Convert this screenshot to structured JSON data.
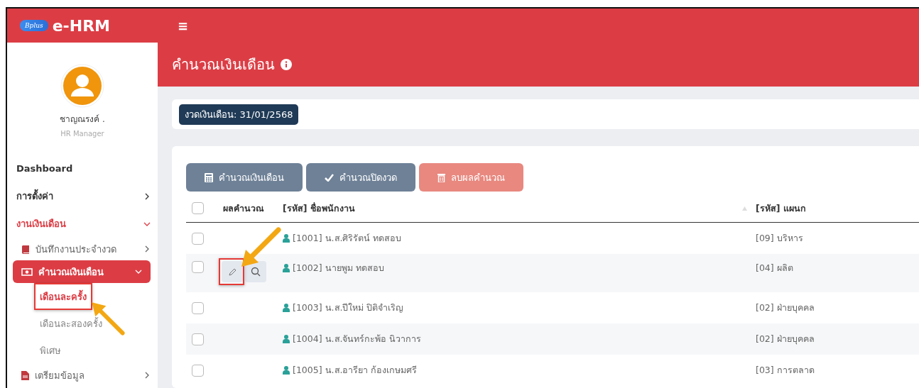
{
  "topbar": {
    "logo_badge": "Bplus",
    "brand": "e-HRM",
    "menu_glyph": "≡"
  },
  "sidebar": {
    "user": {
      "name": "ชาญณรงค์ .",
      "role": "HR Manager"
    },
    "items": [
      {
        "label": "Dashboard",
        "kind": "plain",
        "active": false
      },
      {
        "label": "การตั้งค่า",
        "kind": "group",
        "active": false,
        "expanded": false
      },
      {
        "label": "งานเงินเดือน",
        "kind": "group",
        "active": true,
        "expanded": true,
        "children": [
          {
            "label": "บันทึกงานประจำงวด",
            "kind": "book",
            "selected": false,
            "expanded": false
          },
          {
            "label": "คำนวณเงินเดือน",
            "kind": "money",
            "selected": true,
            "expanded": true,
            "children": [
              {
                "label": "เดือนละครั้ง",
                "selected": true,
                "highlighted": true
              },
              {
                "label": "เดือนละสองครั้ง",
                "selected": false,
                "highlighted": false
              },
              {
                "label": "พิเศษ",
                "selected": false,
                "highlighted": false
              }
            ]
          },
          {
            "label": "เตรียมข้อมูล",
            "kind": "file",
            "selected": false,
            "expanded": false
          }
        ]
      }
    ]
  },
  "page": {
    "title": "คำนวณเงินเดือน",
    "period": "งวดเงินเดือน: 31/01/2568"
  },
  "actions": [
    {
      "label": "คำนวณเงินเดือน",
      "kind": "calculator",
      "disabled": false
    },
    {
      "label": "คำนวณปิดงวด",
      "kind": "check",
      "disabled": false
    },
    {
      "label": "ลบผลคำนวณ",
      "kind": "trash",
      "disabled": false
    }
  ],
  "table": {
    "header_checked": false,
    "columns": [
      "ผลคำนวณ",
      "[รหัส] ชื่อพนักงาน",
      "[รหัส] แผนก"
    ],
    "rows": [
      {
        "checked": false,
        "has_result": false,
        "highlighted": false,
        "employee": "[1001] น.ส.ศิริรัตน์ ทดสอบ",
        "department": "[09] บริหาร"
      },
      {
        "checked": false,
        "has_result": true,
        "highlighted": true,
        "employee": "[1002] นายพูม ทดสอบ",
        "department": "[04] ผลิต"
      },
      {
        "checked": false,
        "has_result": false,
        "highlighted": false,
        "employee": "[1003] น.ส.ปีใหม่ ปิติจำเริญ",
        "department": "[02] ฝ่ายบุคคล"
      },
      {
        "checked": false,
        "has_result": false,
        "highlighted": false,
        "employee": "[1004] น.ส.จันทร์กะพ้อ นิวาการ",
        "department": "[02] ฝ่ายบุคคล"
      },
      {
        "checked": false,
        "has_result": false,
        "highlighted": false,
        "employee": "[1005] น.ส.อารียา ก้องเกษมศรี",
        "department": "[03] การตลาด"
      }
    ]
  }
}
